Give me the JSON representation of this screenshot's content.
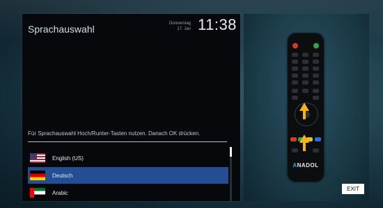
{
  "screen": {
    "title": "Sprachauswahl",
    "date_day": "Donnerstag",
    "date_date": "17. Jan",
    "clock": "11:38",
    "hint": "Für Sprachauswahl Hoch/Runter-Tasten nutzen. Danach OK drücken.",
    "languages": [
      {
        "label": "English (US)",
        "flag": "flag-us-icon",
        "selected": false
      },
      {
        "label": "Deutsch",
        "flag": "flag-de-icon",
        "selected": true
      },
      {
        "label": "Arabic",
        "flag": "flag-ae-icon",
        "selected": false
      }
    ]
  },
  "remote": {
    "brand": "NADOL",
    "brand_mark": "A"
  },
  "footer": {
    "exit_label": "EXIT"
  },
  "colors": {
    "panel_bg": "#06080b",
    "selected": "#244e93",
    "arrow": "#f1b21a"
  }
}
